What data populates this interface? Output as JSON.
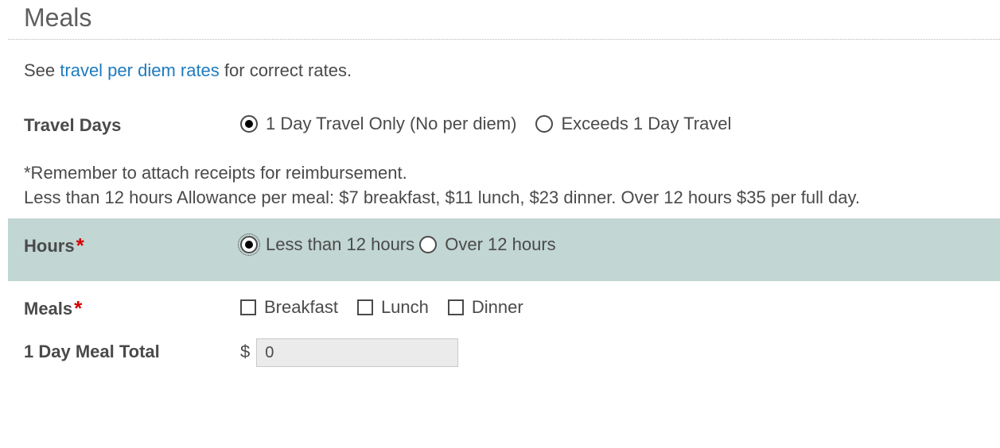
{
  "section": {
    "title": "Meals"
  },
  "intro": {
    "prefix": "See ",
    "link_text": "travel per diem rates",
    "suffix": " for correct rates."
  },
  "travel_days": {
    "label": "Travel Days",
    "options": {
      "one_day": "1 Day Travel Only (No per diem)",
      "exceeds": "Exceeds 1 Day Travel"
    }
  },
  "note": {
    "line1": "*Remember to attach receipts for reimbursement.",
    "line2": "Less than 12 hours Allowance per meal: $7 breakfast, $11 lunch, $23 dinner. Over 12 hours $35 per full day."
  },
  "hours": {
    "label": "Hours",
    "options": {
      "lt12": "Less than 12 hours",
      "gt12": "Over 12 hours"
    }
  },
  "meals": {
    "label": "Meals",
    "options": {
      "breakfast": "Breakfast",
      "lunch": "Lunch",
      "dinner": "Dinner"
    }
  },
  "total": {
    "label": "1 Day Meal Total",
    "currency": "$",
    "value": "0"
  }
}
